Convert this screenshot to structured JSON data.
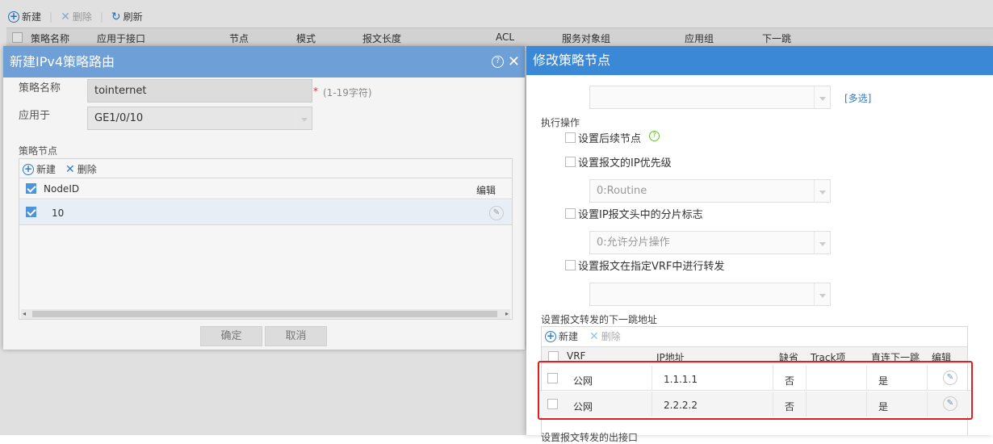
{
  "bg_toolbar": {
    "new_label": "新建",
    "delete_label": "删除",
    "refresh_label": "刷新"
  },
  "bg_table": {
    "columns": [
      "策略名称",
      "应用于接口",
      "节点",
      "模式",
      "报文长度",
      "ACL",
      "服务对象组",
      "应用组",
      "下一跳"
    ]
  },
  "left_dialog": {
    "title": "新建IPv4策略路由",
    "policy_name_label": "策略名称",
    "policy_name_value": "tointernet",
    "policy_name_hint": "(1-19字符)",
    "required_mark": "*",
    "apply_to_label": "应用于",
    "apply_to_value": "GE1/0/10",
    "nodes_section_label": "策略节点",
    "nodes_toolbar": {
      "new_label": "新建",
      "delete_label": "删除"
    },
    "nodes_table": {
      "col_nodeid": "NodeID",
      "col_edit": "编辑",
      "rows": [
        {
          "nodeid": "10"
        }
      ]
    },
    "ok_label": "确定",
    "cancel_label": "取消"
  },
  "right_dialog": {
    "title": "修改策略节点",
    "multi_select_label": "[多选]",
    "execute_label": "执行操作",
    "options": {
      "set_next_node": "设置后续节点",
      "set_ip_priority": "设置报文的IP优先级",
      "ip_priority_value": "0:Routine",
      "set_frag_flag": "设置IP报文头中的分片标志",
      "frag_value": "0:允许分片操作",
      "set_vrf_forward": "设置报文在指定VRF中进行转发"
    },
    "nexthop_section_label": "设置报文转发的下一跳地址",
    "nexthop_toolbar": {
      "new_label": "新建",
      "delete_label": "删除"
    },
    "nexthop_table": {
      "headers": {
        "vrf": "VRF",
        "ip": "IP地址",
        "default": "缺省",
        "track": "Track项",
        "direct": "直连下一跳",
        "edit": "编辑"
      },
      "rows": [
        {
          "vrf": "公网",
          "ip": "1.1.1.1",
          "default": "否",
          "track": "",
          "direct": "是"
        },
        {
          "vrf": "公网",
          "ip": "2.2.2.2",
          "default": "否",
          "track": "",
          "direct": "是"
        }
      ]
    },
    "highlight_color": "#e02020",
    "next_section_cut": "设置报文转发的出接口"
  }
}
